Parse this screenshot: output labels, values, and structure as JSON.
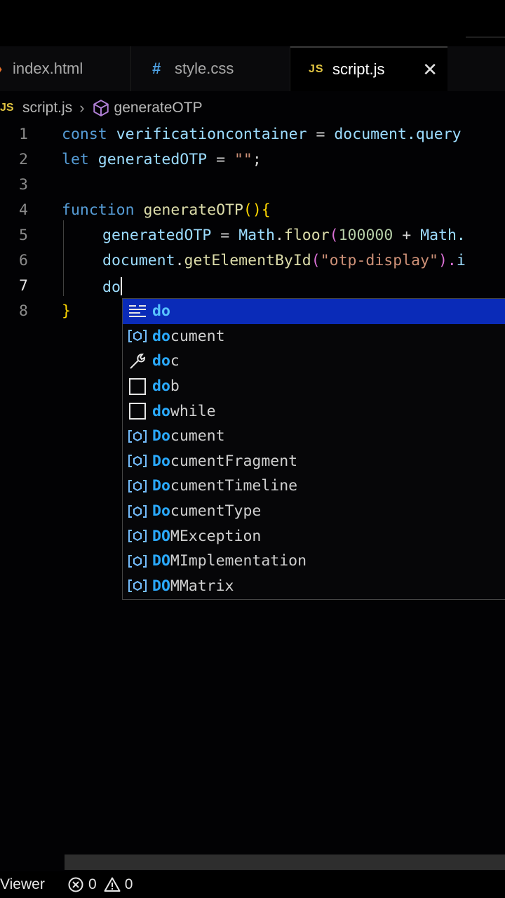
{
  "tabs": [
    {
      "label": "index.html",
      "icon": "html-chevron-icon",
      "icon_glyph": "›"
    },
    {
      "label": "style.css",
      "icon": "css-hash-icon",
      "icon_glyph": "#"
    },
    {
      "label": "script.js",
      "icon": "js-icon",
      "icon_glyph": "JS",
      "active": true
    }
  ],
  "tab_close_glyph": "✕",
  "breadcrumb": {
    "file_icon": "JS",
    "file": "script.js",
    "separator": "›",
    "symbol": "generateOTP"
  },
  "editor": {
    "line_numbers": [
      "1",
      "2",
      "3",
      "4",
      "5",
      "6",
      "7",
      "8"
    ],
    "active_line": "7",
    "lines": {
      "l1": {
        "kw": "const",
        "var": "verificationcontainer",
        "op": " = ",
        "rest": "document.query"
      },
      "l2": {
        "kw": "let",
        "var": "generatedOTP",
        "op": " = ",
        "str": "\"\"",
        "end": ";"
      },
      "l4": {
        "kw": "function",
        "fn": "generateOTP",
        "paren": "()",
        "brace": "{"
      },
      "l5": {
        "var": "generatedOTP",
        "op": " = ",
        "obj": "Math",
        "dot": ".",
        "fn": "floor",
        "open": "(",
        "num": "100000",
        "plus": " + ",
        "obj2": "Math."
      },
      "l6": {
        "obj": "document",
        "dot": ".",
        "fn": "getElementById",
        "open": "(",
        "str": "\"otp-display\"",
        "close": ").",
        "rest": "i"
      },
      "l7": {
        "typed": "do"
      },
      "l8": {
        "brace": "}"
      }
    }
  },
  "suggestions": [
    {
      "match": "do",
      "rest": "",
      "icon": "keyword-icon",
      "selected": true
    },
    {
      "match": "do",
      "rest": "cument",
      "icon": "variable-icon"
    },
    {
      "match": "do",
      "rest": "c",
      "icon": "wrench-icon"
    },
    {
      "match": "do",
      "rest": "b",
      "icon": "snippet-icon"
    },
    {
      "match": "do",
      "rest": "while",
      "icon": "snippet-icon"
    },
    {
      "match": "Do",
      "rest": "cument",
      "icon": "variable-icon"
    },
    {
      "match": "Do",
      "rest": "cumentFragment",
      "icon": "variable-icon"
    },
    {
      "match": "Do",
      "rest": "cumentTimeline",
      "icon": "variable-icon"
    },
    {
      "match": "Do",
      "rest": "cumentType",
      "icon": "variable-icon"
    },
    {
      "match": "DO",
      "rest": "MException",
      "icon": "variable-icon"
    },
    {
      "match": "DO",
      "rest": "MImplementation",
      "icon": "variable-icon"
    },
    {
      "match": "DO",
      "rest": "MMatrix",
      "icon": "variable-icon"
    }
  ],
  "statusbar": {
    "viewer": "Viewer",
    "errors": "0",
    "warnings": "0"
  },
  "colors": {
    "keyword": "#569cd6",
    "function": "#dcdcaa",
    "variable": "#9cdcfe",
    "string": "#ce9178",
    "number": "#b5cea8",
    "selection": "#0a2bb8",
    "match": "#2aaaff"
  }
}
